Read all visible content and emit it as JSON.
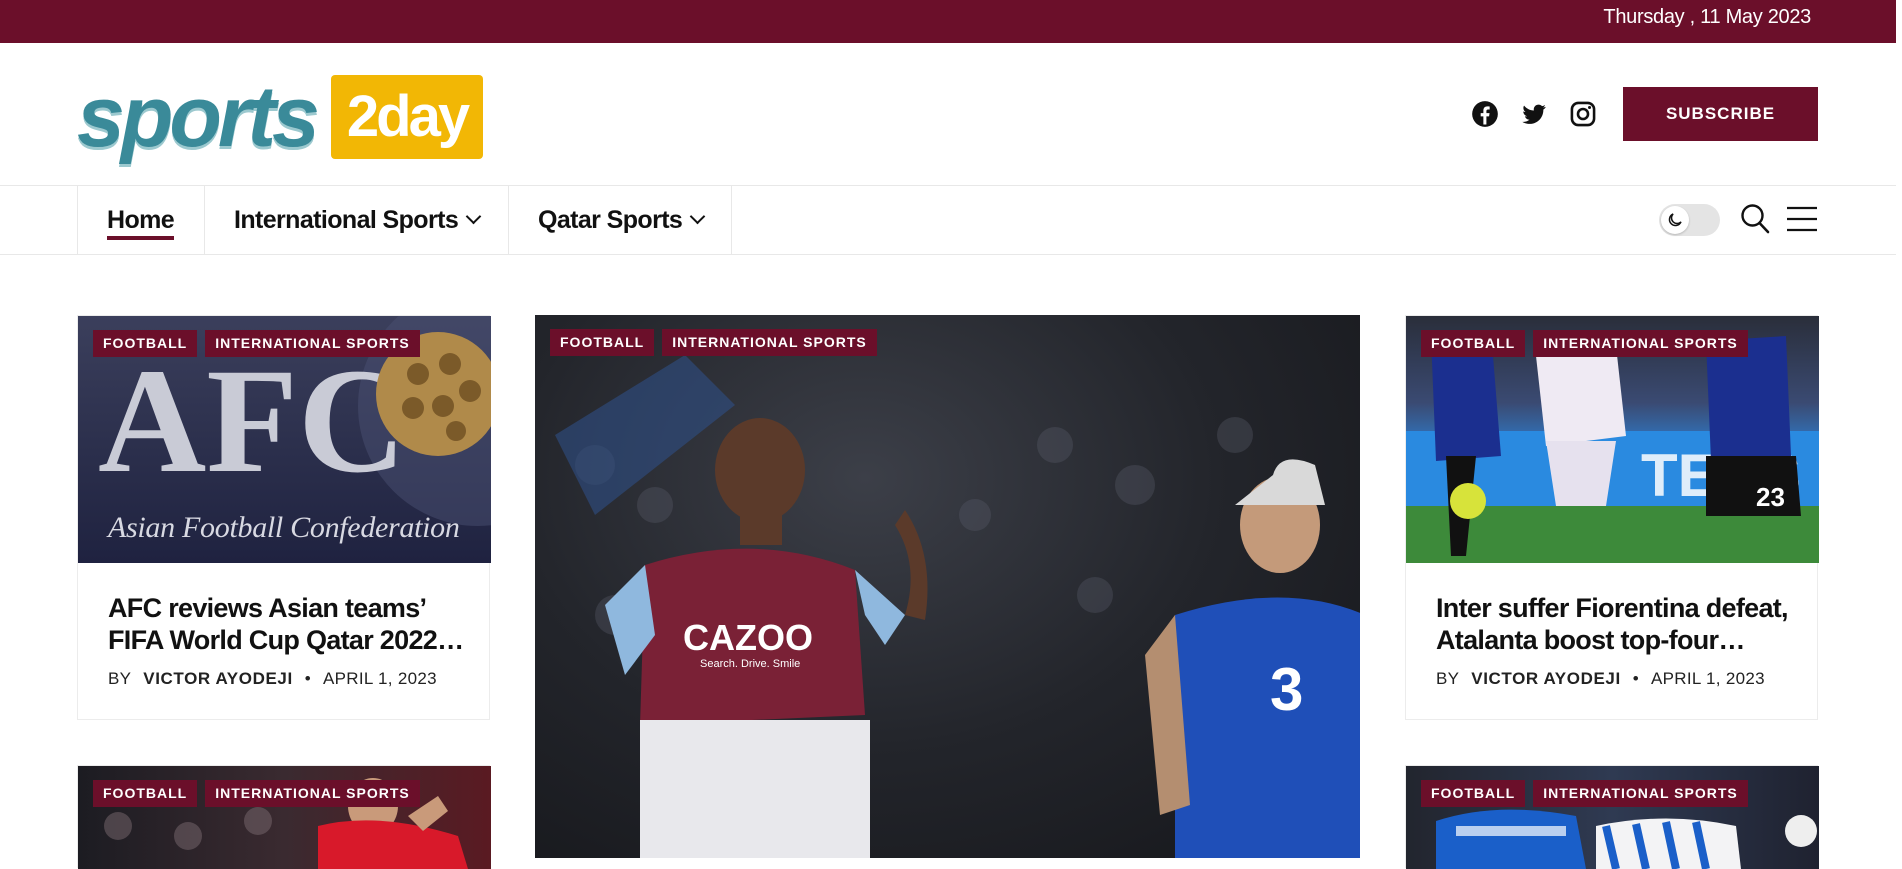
{
  "topbar": {
    "date": "Thursday , 11 May 2023"
  },
  "brand": {
    "part1": "sports",
    "part2": "2day"
  },
  "social": {
    "icons": [
      "facebook-icon",
      "twitter-icon",
      "instagram-icon"
    ]
  },
  "header": {
    "subscribe_label": "SUBSCRIBE"
  },
  "nav": {
    "home": "Home",
    "international": "International Sports",
    "qatar": "Qatar Sports"
  },
  "colors": {
    "brand": "#6b0f2a",
    "accent_yellow": "#f2b705",
    "accent_teal": "#3a8a99"
  },
  "articles": [
    {
      "tags": [
        "FOOTBALL",
        "INTERNATIONAL SPORTS"
      ],
      "title_line1": "AFC reviews Asian teams’",
      "title_line2": "FIFA World Cup Qatar 2022…",
      "image_caption": "Asian Football Confederation",
      "image_logo": "AFC",
      "by": "BY",
      "author": "VICTOR AYODEJI",
      "date": "APRIL 1, 2023"
    },
    {
      "tags": [
        "FOOTBALL",
        "INTERNATIONAL SPORTS"
      ],
      "jersey_sponsor": "CAZOO",
      "jersey_slogan": "Search. Drive. Smile"
    },
    {
      "tags": [
        "FOOTBALL",
        "INTERNATIONAL SPORTS"
      ],
      "title_line1": "Inter suffer Fiorentina defeat,",
      "title_line2": "Atalanta boost top-four…",
      "by": "BY",
      "author": "VICTOR AYODEJI",
      "date": "APRIL 1, 2023"
    },
    {
      "tags": [
        "FOOTBALL",
        "INTERNATIONAL SPORTS"
      ]
    },
    {
      "tags": [
        "FOOTBALL",
        "INTERNATIONAL SPORTS"
      ]
    }
  ]
}
